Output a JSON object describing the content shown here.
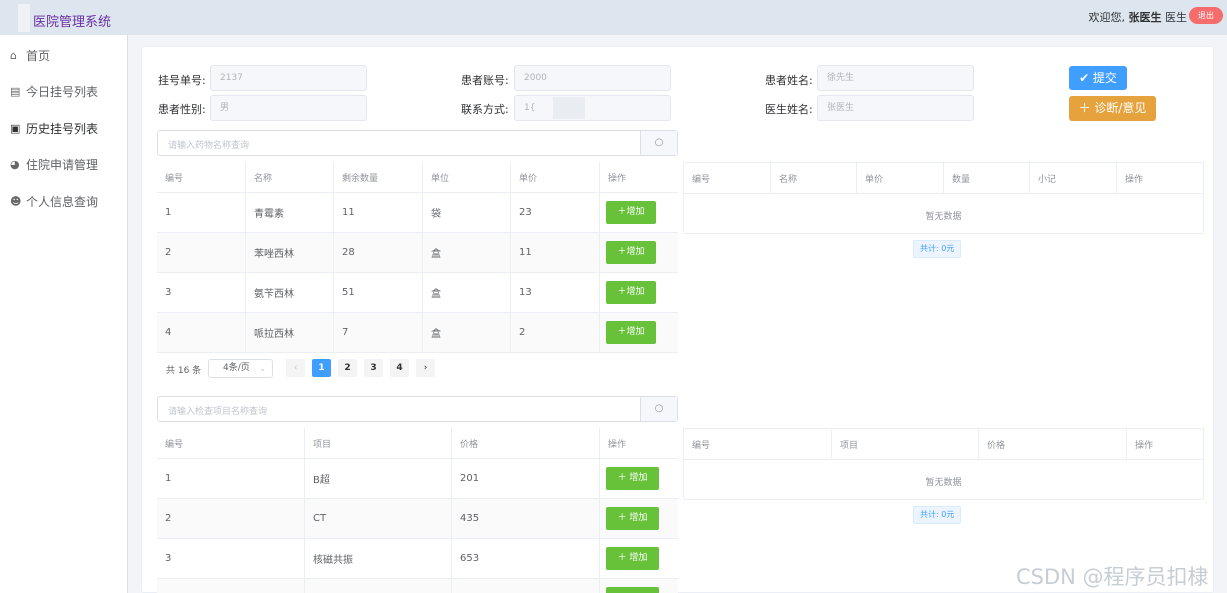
{
  "header": {
    "title": "医院管理系统",
    "welcome_prefix": "欢迎您,",
    "user_name": "张医生",
    "user_role": "医生",
    "logout_label": "退出"
  },
  "sidebar": {
    "items": [
      {
        "label": "首页",
        "icon": "home-icon"
      },
      {
        "label": "今日挂号列表",
        "icon": "list-icon"
      },
      {
        "label": "历史挂号列表",
        "icon": "history-icon"
      },
      {
        "label": "住院申请管理",
        "icon": "inpatient-icon"
      },
      {
        "label": "个人信息查询",
        "icon": "user-icon"
      }
    ]
  },
  "form": {
    "reg_no_label": "挂号单号:",
    "reg_no_value": "2137",
    "patient_account_label": "患者账号:",
    "patient_account_value": "2000",
    "patient_name_label": "患者姓名:",
    "patient_name_value": "徐先生",
    "gender_label": "患者性别:",
    "gender_value": "男",
    "phone_label": "联系方式:",
    "phone_value": "1{",
    "doctor_name_label": "医生姓名:",
    "doctor_name_value": "张医生",
    "submit_label": "✔ 提交",
    "diagnose_label": "＋ 诊断/意见"
  },
  "drug_search": {
    "placeholder": "请输入药物名称查询",
    "icon": "search-icon"
  },
  "drug_table": {
    "headers": [
      "编号",
      "名称",
      "剩余数量",
      "单位",
      "单价",
      "操作"
    ],
    "rows": [
      {
        "id": "1",
        "name": "青霉素",
        "qty": "11",
        "unit": "袋",
        "price": "23"
      },
      {
        "id": "2",
        "name": "苯唑西林",
        "qty": "28",
        "unit": "盒",
        "price": "11"
      },
      {
        "id": "3",
        "name": "氨苄西林",
        "qty": "51",
        "unit": "盒",
        "price": "13"
      },
      {
        "id": "4",
        "name": "哌拉西林",
        "qty": "7",
        "unit": "盒",
        "price": "2"
      }
    ],
    "add_label": "＋增加"
  },
  "drug_pager": {
    "total": "共 16 条",
    "page_size": "4条/页",
    "pages": [
      "1",
      "2",
      "3",
      "4"
    ],
    "prev": "‹",
    "next": "›"
  },
  "drug_selected": {
    "headers": [
      "编号",
      "名称",
      "单价",
      "数量",
      "小记",
      "操作"
    ],
    "empty_text": "暂无数据",
    "total_text": "共计: 0元"
  },
  "exam_search": {
    "placeholder": "请输入检查项目名称查询",
    "icon": "search-icon"
  },
  "exam_table": {
    "headers": [
      "编号",
      "项目",
      "价格",
      "操作"
    ],
    "rows": [
      {
        "id": "1",
        "item": "B超",
        "price": "201"
      },
      {
        "id": "2",
        "item": "CT",
        "price": "435"
      },
      {
        "id": "3",
        "item": "核磁共振",
        "price": "653"
      }
    ],
    "add_label": "＋ 增加"
  },
  "exam_selected": {
    "headers": [
      "编号",
      "项目",
      "价格",
      "操作"
    ],
    "empty_text": "暂无数据",
    "total_text": "共计: 0元"
  },
  "watermark": "CSDN @程序员扣棣"
}
